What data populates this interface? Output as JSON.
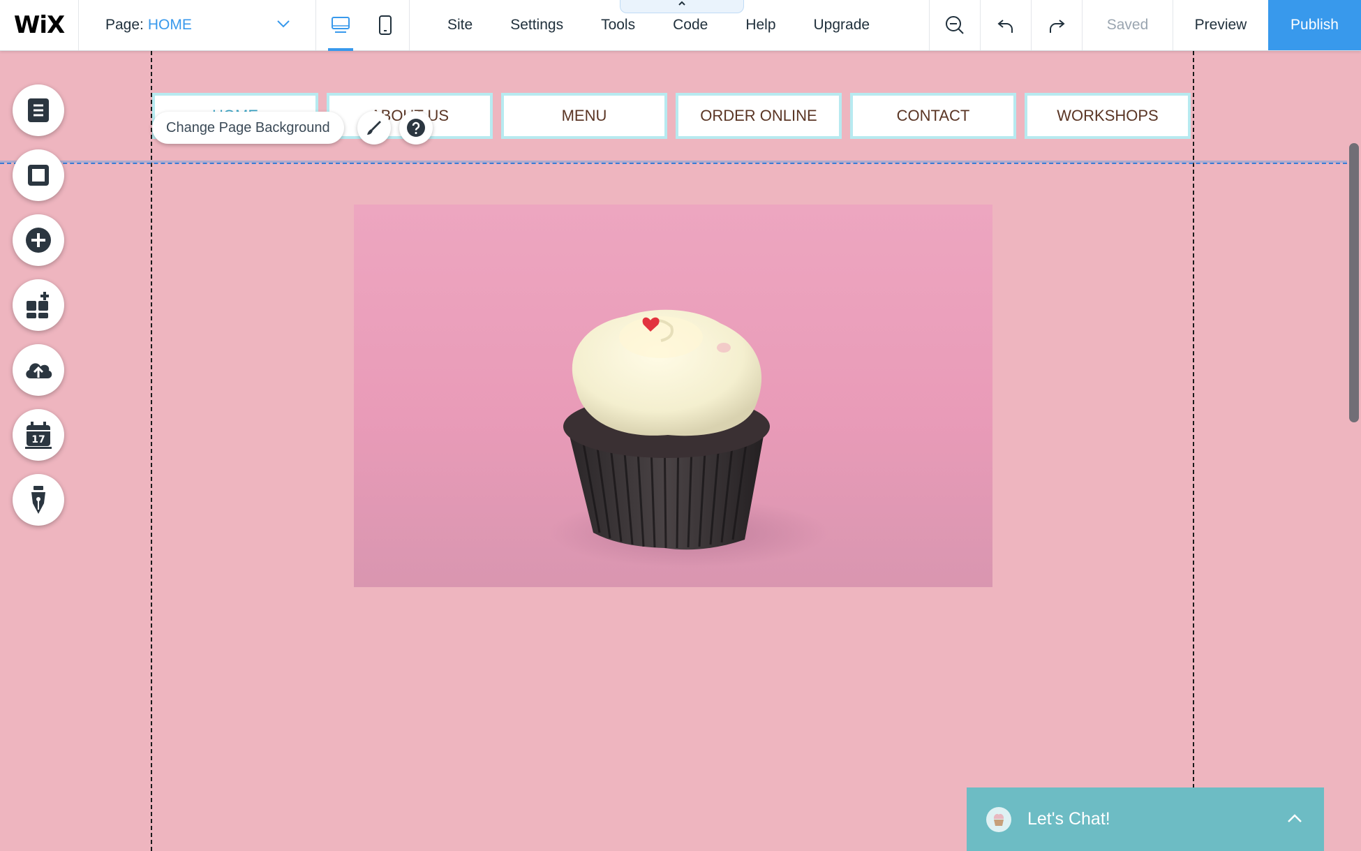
{
  "app": {
    "logo": "WiX"
  },
  "page_selector": {
    "label": "Page:",
    "value": "HOME"
  },
  "menu": [
    "Site",
    "Settings",
    "Tools",
    "Code",
    "Help",
    "Upgrade"
  ],
  "status": {
    "saved": "Saved",
    "preview": "Preview",
    "publish": "Publish"
  },
  "site_nav": [
    "HOME",
    "ABOUT US",
    "MENU",
    "ORDER ONLINE",
    "CONTACT",
    "WORKSHOPS"
  ],
  "tooltip": {
    "label": "Change Page Background"
  },
  "chat": {
    "title": "Let's Chat!"
  },
  "colors": {
    "accent": "#3899ec",
    "canvas": "#eeb5bf",
    "nav_text": "#5a3524",
    "chat": "#6dbcc4"
  },
  "icons": {
    "sidebar": [
      "pages-icon",
      "background-icon",
      "add-icon",
      "app-market-icon",
      "upload-icon",
      "bookings-calendar-icon",
      "blog-pen-icon"
    ],
    "toolbar": [
      "zoom-out-icon",
      "undo-icon",
      "redo-icon"
    ]
  }
}
